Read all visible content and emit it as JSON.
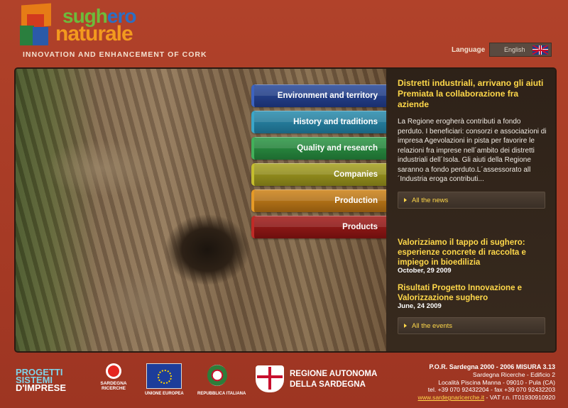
{
  "header": {
    "logo_line1a": "sugh",
    "logo_line1b": "ero",
    "logo_line2": "naturale",
    "tagline": "INNOVATION AND ENHANCEMENT OF CORK",
    "language_label": "Language",
    "language_value": "English"
  },
  "nav": {
    "items": [
      {
        "label": "Environment and territory",
        "color": "#2b4c9c"
      },
      {
        "label": "History and traditions",
        "color": "#2d8fb0"
      },
      {
        "label": "Quality and research",
        "color": "#2f9a48"
      },
      {
        "label": "Companies",
        "color": "#a9a322"
      },
      {
        "label": "Production",
        "color": "#d0861c"
      },
      {
        "label": "Products",
        "color": "#a61f1c"
      }
    ]
  },
  "news": {
    "headline": "Distretti industriali, arrivano gli aiuti Premiata la collaborazione fra aziende",
    "body": "La Regione erogherà contributi a fondo perduto. I beneficiari: consorzi e associazioni di impresa Agevolazioni in pista per favorire le relazioni fra imprese nell´ambito dei distretti industriali dell´Isola. Gli aiuti della Regione saranno a fondo perduto.L´assessorato all´Industria eroga contributi...",
    "all_news": "All the news"
  },
  "events": {
    "items": [
      {
        "title": "Valorizziamo il tappo di sughero: esperienze concrete di raccolta e impiego in bioedilizia",
        "date": "October, 29 2009"
      },
      {
        "title": "Risultati Progetto Innovazione e Valorizzazione sughero",
        "date": "June, 24 2009"
      }
    ],
    "all_events": "All the events"
  },
  "footer": {
    "progetti_1": "PROGETTI",
    "progetti_2": "SISTEMI",
    "progetti_3": "D'IMPRESE",
    "sardegna_ricerche": "SARDEGNA RICERCHE",
    "unione_europea": "UNIONE EUROPEA",
    "repubblica_italiana": "REPUBBLICA ITALIANA",
    "regione_1": "REGIONE AUTONOMA",
    "regione_2": "DELLA SARDEGNA",
    "contact_1": "P.O.R. Sardegna 2000 - 2006 MISURA 3.13",
    "contact_2": "Sardegna Ricerche - Edificio 2",
    "contact_3": "Località Piscina Manna - 09010 - Pula (CA)",
    "contact_4": "tel. +39 070 92432204 - fax +39 070 92432203",
    "contact_link": "www.sardegnaricerche.it",
    "contact_5": " - VAT r.n. IT01930910920"
  }
}
